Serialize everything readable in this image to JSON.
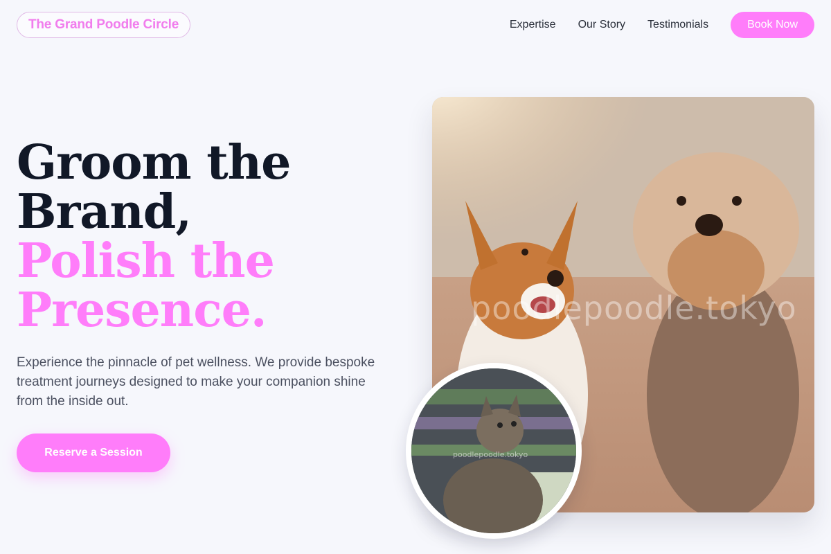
{
  "header": {
    "logo": "The Grand Poodle Circle",
    "nav": [
      {
        "label": "Expertise"
      },
      {
        "label": "Our Story"
      },
      {
        "label": "Testimonials"
      }
    ],
    "cta": "Book Now"
  },
  "hero": {
    "title_lines": [
      "Groom the",
      "Brand,"
    ],
    "accent_lines": [
      "Polish the",
      "Presence."
    ],
    "description": "Experience the pinnacle of pet wellness. We provide bespoke treatment journeys designed to make your companion shine from the inside out.",
    "button": "Reserve a Session"
  },
  "images": {
    "main_watermark": "poodlepoodle.tokyo",
    "inset_watermark": "poodlepoodle.tokyo"
  },
  "colors": {
    "accent": "#ff7dfa",
    "heading": "#111827",
    "body_text": "#4b5060",
    "background": "#f6f7fc"
  }
}
